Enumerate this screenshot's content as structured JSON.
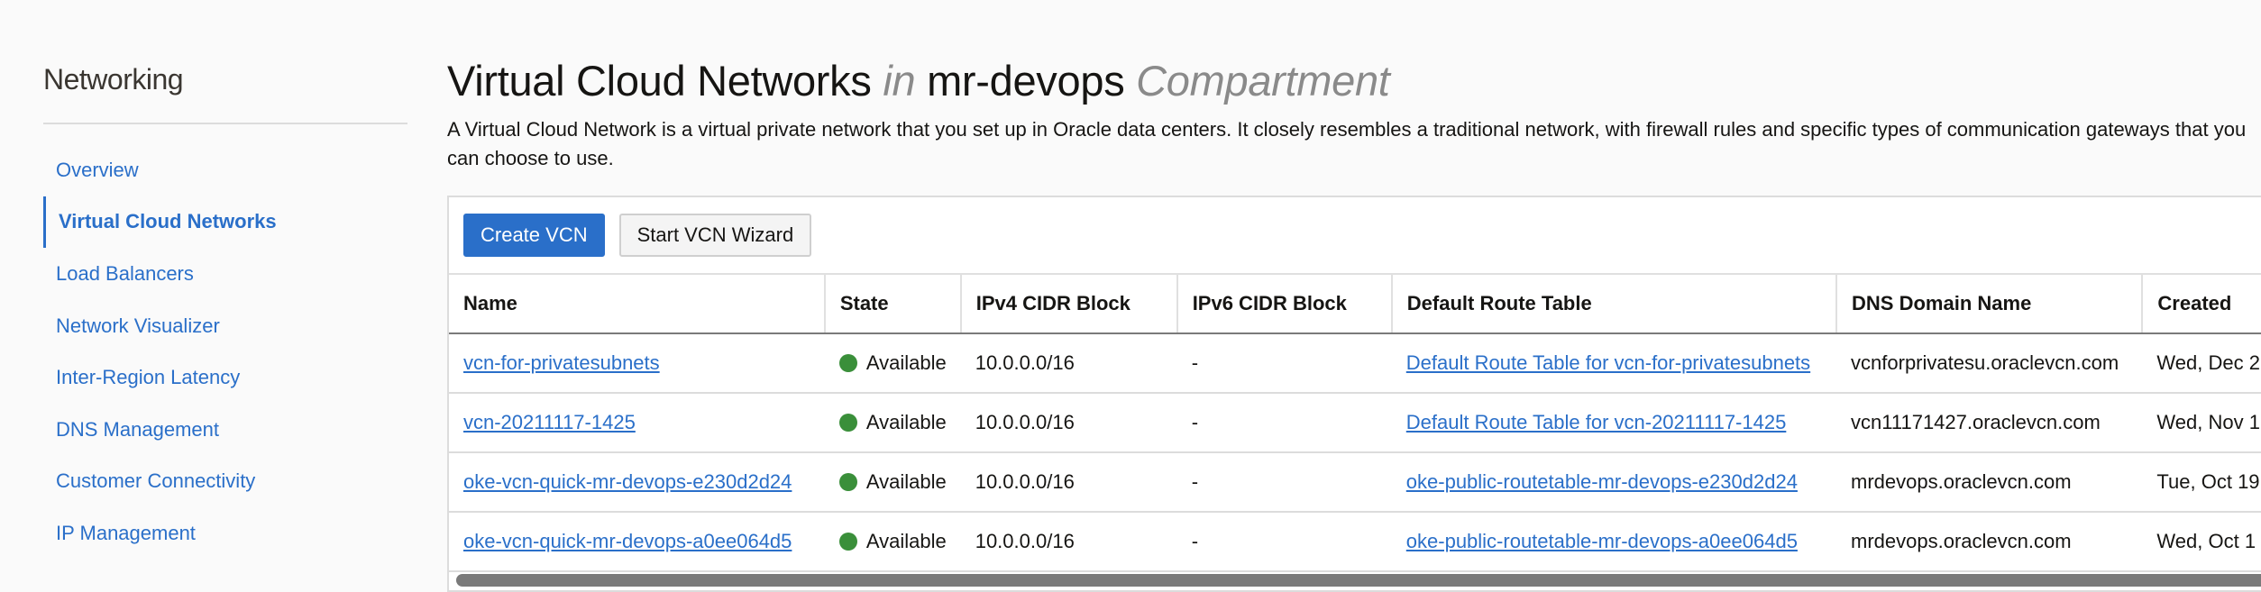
{
  "sidebar": {
    "title": "Networking",
    "items": [
      {
        "label": "Overview",
        "active": false
      },
      {
        "label": "Virtual Cloud Networks",
        "active": true
      },
      {
        "label": "Load Balancers",
        "active": false
      },
      {
        "label": "Network Visualizer",
        "active": false
      },
      {
        "label": "Inter-Region Latency",
        "active": false
      },
      {
        "label": "DNS Management",
        "active": false
      },
      {
        "label": "Customer Connectivity",
        "active": false
      },
      {
        "label": "IP Management",
        "active": false
      }
    ]
  },
  "header": {
    "title_main": "Virtual Cloud Networks",
    "title_in": "in",
    "compartment": "mr-devops",
    "title_suffix": "Compartment",
    "description": "A Virtual Cloud Network is a virtual private network that you set up in Oracle data centers. It closely resembles a traditional network, with firewall rules and specific types of communication gateways that you can choose to use."
  },
  "toolbar": {
    "create_label": "Create VCN",
    "wizard_label": "Start VCN Wizard"
  },
  "table": {
    "columns": [
      "Name",
      "State",
      "IPv4 CIDR Block",
      "IPv6 CIDR Block",
      "Default Route Table",
      "DNS Domain Name",
      "Created"
    ],
    "rows": [
      {
        "name": "vcn-for-privatesubnets",
        "state": "Available",
        "ipv4": "10.0.0.0/16",
        "ipv6": "-",
        "route_table": "Default Route Table for vcn-for-privatesubnets",
        "dns": "vcnforprivatesu.oraclevcn.com",
        "created": "Wed, Dec 2"
      },
      {
        "name": "vcn-20211117-1425",
        "state": "Available",
        "ipv4": "10.0.0.0/16",
        "ipv6": "-",
        "route_table": "Default Route Table for vcn-20211117-1425",
        "dns": "vcn11171427.oraclevcn.com",
        "created": "Wed, Nov 1"
      },
      {
        "name": "oke-vcn-quick-mr-devops-e230d2d24",
        "state": "Available",
        "ipv4": "10.0.0.0/16",
        "ipv6": "-",
        "route_table": "oke-public-routetable-mr-devops-e230d2d24",
        "dns": "mrdevops.oraclevcn.com",
        "created": "Tue, Oct 19"
      },
      {
        "name": "oke-vcn-quick-mr-devops-a0ee064d5",
        "state": "Available",
        "ipv4": "10.0.0.0/16",
        "ipv6": "-",
        "route_table": "oke-public-routetable-mr-devops-a0ee064d5",
        "dns": "mrdevops.oraclevcn.com",
        "created": "Wed, Oct 1"
      }
    ]
  },
  "colors": {
    "accent": "#2a6fc9",
    "available": "#3a8f3a"
  }
}
